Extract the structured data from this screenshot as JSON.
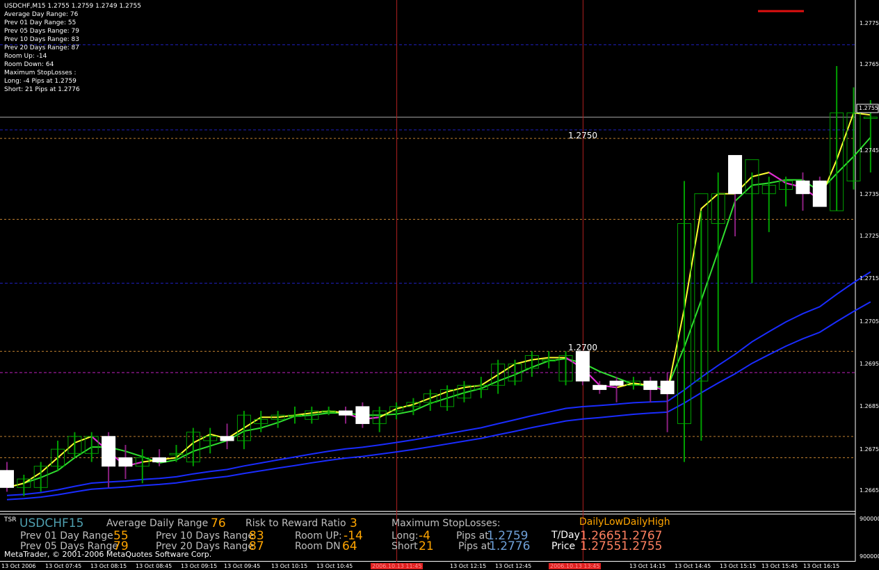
{
  "window": {
    "symbol_header": "USDCHF,M15  1.2755 1.2759 1.2749 1.2755"
  },
  "info_panel": [
    "Average Day  Range: 76",
    "Prev 01  Day  Range: 55",
    "Prev 05  Days Range: 79",
    "Prev 10  Days Range: 83",
    "Prev 20  Days Range: 87",
    "Room Up:     -14",
    "Room Down: 64",
    "Maximum StopLosses :",
    "Long:  -4 Pips at 1.2759",
    "Short: 21 Pips at 1.2776"
  ],
  "price_axis": {
    "labels": [
      "1.2775",
      "1.2765",
      "1.2755",
      "1.2745",
      "1.2735",
      "1.2725",
      "1.2715",
      "1.2705",
      "1.2695",
      "1.2685",
      "1.2675",
      "1.2665"
    ],
    "current_price": "1.2755"
  },
  "levels": {
    "upper_label": "1.2750",
    "lower_label": "1.2700"
  },
  "time_axis": {
    "labels": [
      "13 Oct 2006",
      "13 Oct 07:45",
      "13 Oct 08:15",
      "13 Oct 08:45",
      "13 Oct 09:15",
      "13 Oct 09:45",
      "13 Oct 10:15",
      "13 Oct 10:45",
      "13 Oct 12:15",
      "13 Oct 12:45",
      "13 Oct 14:15",
      "13 Oct 14:45",
      "13 Oct 15:15",
      "13 Oct 15:45",
      "13 Oct 16:15"
    ],
    "highlight_labels": [
      "2006.10.13 11:45",
      "2006.10.13 13:45"
    ]
  },
  "subwindow": {
    "indicator_tag": "TSR",
    "axis_labels": [
      "9000000",
      "9000000"
    ],
    "symbol": "USDCHF",
    "timeframe": "15",
    "avg_daily_range_label": "Average Daily Range",
    "avg_daily_range_value": "76",
    "risk_reward_label": "Risk to Reward Ratio",
    "risk_reward_value": "3",
    "max_sl_label": "Maximum StopLosses:",
    "daily_low_high_label": "DailyLowDailyHigh",
    "prev01_label": "Prev 01 Day Range",
    "prev01_value": "55",
    "prev05_label": "Prev 05 Days Range",
    "prev05_value": "79",
    "prev10_label": "Prev 10 Days Range",
    "prev10_value": "83",
    "prev20_label": "Prev 20 Days Range",
    "prev20_value": "87",
    "room_up_label": "Room UP:",
    "room_up_value": "-14",
    "room_dn_label": "Room DN",
    "room_dn_value": "64",
    "long_label": "Long:",
    "long_value": "-4",
    "short_label": "Short",
    "short_value": "21",
    "pips_at_label_1": "Pips at",
    "pips_at_value_1": "1.2759",
    "pips_at_label_2": "Pips at",
    "pips_at_value_2": "1.2776",
    "tday_label": "T/Day",
    "tday_low": "1.2665",
    "tday_high": "1.2767",
    "price_label": "Price",
    "price_low": "1.2755",
    "price_high": "1.2755",
    "copyright": "MetaTrader, © 2001-2006 MetaQuotes Software Corp."
  },
  "colors": {
    "background": "#000000",
    "bull_candle": "#00a000",
    "bear_candle": "#ffffff",
    "ma_blue": "#1a2cff",
    "ma_green": "#30e030",
    "ma_yellow": "#ffff30",
    "ma_red": "#e01010",
    "ma_magenta": "#e020e0",
    "session_line": "#b02020"
  },
  "chart_data": {
    "type": "candlestick",
    "symbol": "USDCHF",
    "timeframe": "M15",
    "ylim": [
      1.26625,
      1.27825
    ],
    "candles": [
      {
        "o": 1.2672,
        "h": 1.2674,
        "l": 1.2667,
        "c": 1.2668
      },
      {
        "o": 1.2668,
        "h": 1.2671,
        "l": 1.2666,
        "c": 1.267
      },
      {
        "o": 1.2668,
        "h": 1.2674,
        "l": 1.2667,
        "c": 1.2673
      },
      {
        "o": 1.2673,
        "h": 1.2679,
        "l": 1.2672,
        "c": 1.2677
      },
      {
        "o": 1.2676,
        "h": 1.2681,
        "l": 1.2675,
        "c": 1.268
      },
      {
        "o": 1.2676,
        "h": 1.2681,
        "l": 1.2674,
        "c": 1.268
      },
      {
        "o": 1.268,
        "h": 1.2681,
        "l": 1.2668,
        "c": 1.2673
      },
      {
        "o": 1.2675,
        "h": 1.2678,
        "l": 1.267,
        "c": 1.2673
      },
      {
        "o": 1.2673,
        "h": 1.2677,
        "l": 1.2669,
        "c": 1.2675
      },
      {
        "o": 1.2675,
        "h": 1.2677,
        "l": 1.2673,
        "c": 1.2674
      },
      {
        "o": 1.2676,
        "h": 1.2678,
        "l": 1.2674,
        "c": 1.2676
      },
      {
        "o": 1.2674,
        "h": 1.2682,
        "l": 1.2673,
        "c": 1.2681
      },
      {
        "o": 1.2679,
        "h": 1.2682,
        "l": 1.2676,
        "c": 1.268
      },
      {
        "o": 1.268,
        "h": 1.2683,
        "l": 1.2677,
        "c": 1.2679
      },
      {
        "o": 1.2679,
        "h": 1.2686,
        "l": 1.2677,
        "c": 1.2685
      },
      {
        "o": 1.2683,
        "h": 1.2686,
        "l": 1.2681,
        "c": 1.2684
      },
      {
        "o": 1.2684,
        "h": 1.2686,
        "l": 1.2682,
        "c": 1.2685
      },
      {
        "o": 1.2685,
        "h": 1.2687,
        "l": 1.2683,
        "c": 1.2685
      },
      {
        "o": 1.2684,
        "h": 1.2687,
        "l": 1.2683,
        "c": 1.2686
      },
      {
        "o": 1.2686,
        "h": 1.2687,
        "l": 1.2685,
        "c": 1.2686
      },
      {
        "o": 1.2686,
        "h": 1.2687,
        "l": 1.2683,
        "c": 1.2685
      },
      {
        "o": 1.2687,
        "h": 1.2688,
        "l": 1.2682,
        "c": 1.2683
      },
      {
        "o": 1.2683,
        "h": 1.2687,
        "l": 1.2681,
        "c": 1.2686
      },
      {
        "o": 1.2686,
        "h": 1.2688,
        "l": 1.2684,
        "c": 1.2687
      },
      {
        "o": 1.2687,
        "h": 1.2689,
        "l": 1.2685,
        "c": 1.2688
      },
      {
        "o": 1.2688,
        "h": 1.2691,
        "l": 1.2686,
        "c": 1.269
      },
      {
        "o": 1.2687,
        "h": 1.2692,
        "l": 1.2686,
        "c": 1.2691
      },
      {
        "o": 1.2689,
        "h": 1.2693,
        "l": 1.2688,
        "c": 1.2692
      },
      {
        "o": 1.2691,
        "h": 1.2694,
        "l": 1.2689,
        "c": 1.2692
      },
      {
        "o": 1.2692,
        "h": 1.2698,
        "l": 1.269,
        "c": 1.2697
      },
      {
        "o": 1.2693,
        "h": 1.2698,
        "l": 1.2692,
        "c": 1.2697
      },
      {
        "o": 1.2696,
        "h": 1.27,
        "l": 1.2694,
        "c": 1.2699
      },
      {
        "o": 1.2698,
        "h": 1.27,
        "l": 1.2696,
        "c": 1.2698
      },
      {
        "o": 1.2693,
        "h": 1.27,
        "l": 1.2692,
        "c": 1.2699
      },
      {
        "o": 1.27,
        "h": 1.27,
        "l": 1.2692,
        "c": 1.2693
      },
      {
        "o": 1.2692,
        "h": 1.2693,
        "l": 1.269,
        "c": 1.2691
      },
      {
        "o": 1.2693,
        "h": 1.2694,
        "l": 1.2688,
        "c": 1.2692
      },
      {
        "o": 1.2692,
        "h": 1.2694,
        "l": 1.2691,
        "c": 1.2693
      },
      {
        "o": 1.2693,
        "h": 1.2694,
        "l": 1.2688,
        "c": 1.2691
      },
      {
        "o": 1.2693,
        "h": 1.2695,
        "l": 1.2681,
        "c": 1.269
      },
      {
        "o": 1.2683,
        "h": 1.274,
        "l": 1.2674,
        "c": 1.273
      },
      {
        "o": 1.2693,
        "h": 1.2733,
        "l": 1.2679,
        "c": 1.2737
      },
      {
        "o": 1.273,
        "h": 1.2742,
        "l": 1.27,
        "c": 1.2737
      },
      {
        "o": 1.2746,
        "h": 1.2746,
        "l": 1.2727,
        "c": 1.2737
      },
      {
        "o": 1.2737,
        "h": 1.2742,
        "l": 1.2716,
        "c": 1.2745
      },
      {
        "o": 1.2737,
        "h": 1.2741,
        "l": 1.2728,
        "c": 1.2739
      },
      {
        "o": 1.2738,
        "h": 1.2741,
        "l": 1.2734,
        "c": 1.274
      },
      {
        "o": 1.274,
        "h": 1.2742,
        "l": 1.2733,
        "c": 1.2737
      },
      {
        "o": 1.274,
        "h": 1.2741,
        "l": 1.2734,
        "c": 1.2734
      },
      {
        "o": 1.2733,
        "h": 1.2767,
        "l": 1.2733,
        "c": 1.2756
      },
      {
        "o": 1.274,
        "h": 1.2762,
        "l": 1.2738,
        "c": 1.2756
      },
      {
        "o": 1.2755,
        "h": 1.2759,
        "l": 1.2742,
        "c": 1.2755
      }
    ],
    "horizontal_levels": {
      "orange_dotted": [
        1.275,
        1.2731,
        1.27,
        1.268,
        1.2675
      ],
      "blue_dashed": [
        1.2772,
        1.2752,
        1.2716
      ],
      "magenta_dashed": [
        1.2695
      ],
      "gray_solid": [
        1.2755
      ]
    },
    "session_lines_candle_index": [
      23,
      34
    ]
  }
}
